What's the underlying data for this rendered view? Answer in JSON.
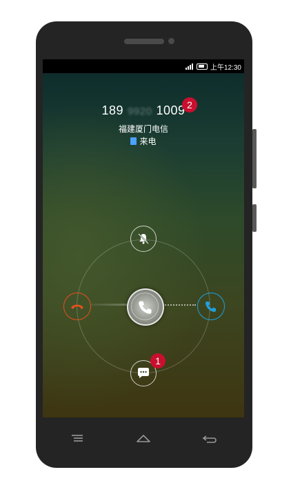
{
  "status_bar": {
    "time": "上午12:30",
    "signal_icon": "signal-bars-icon",
    "battery_icon": "battery-icon"
  },
  "call": {
    "number_start": "189",
    "number_middle": "9920",
    "number_end": "1009",
    "location": "福建厦门电信",
    "status_label": "来电",
    "status_icon": "document-icon"
  },
  "badges": {
    "number_badge": "2",
    "message_badge": "1"
  },
  "actions": {
    "mute": "bell-mute-icon",
    "decline": "decline-call-icon",
    "answer": "answer-call-icon",
    "drag_handle": "phone-handle-icon",
    "message": "message-bubble-icon"
  },
  "nav": {
    "menu": "menu-icon",
    "home": "home-icon",
    "back": "back-icon"
  },
  "colors": {
    "decline": "#e8501c",
    "answer": "#1ea0e0",
    "badge": "#c8102e",
    "frame": "#242424"
  }
}
